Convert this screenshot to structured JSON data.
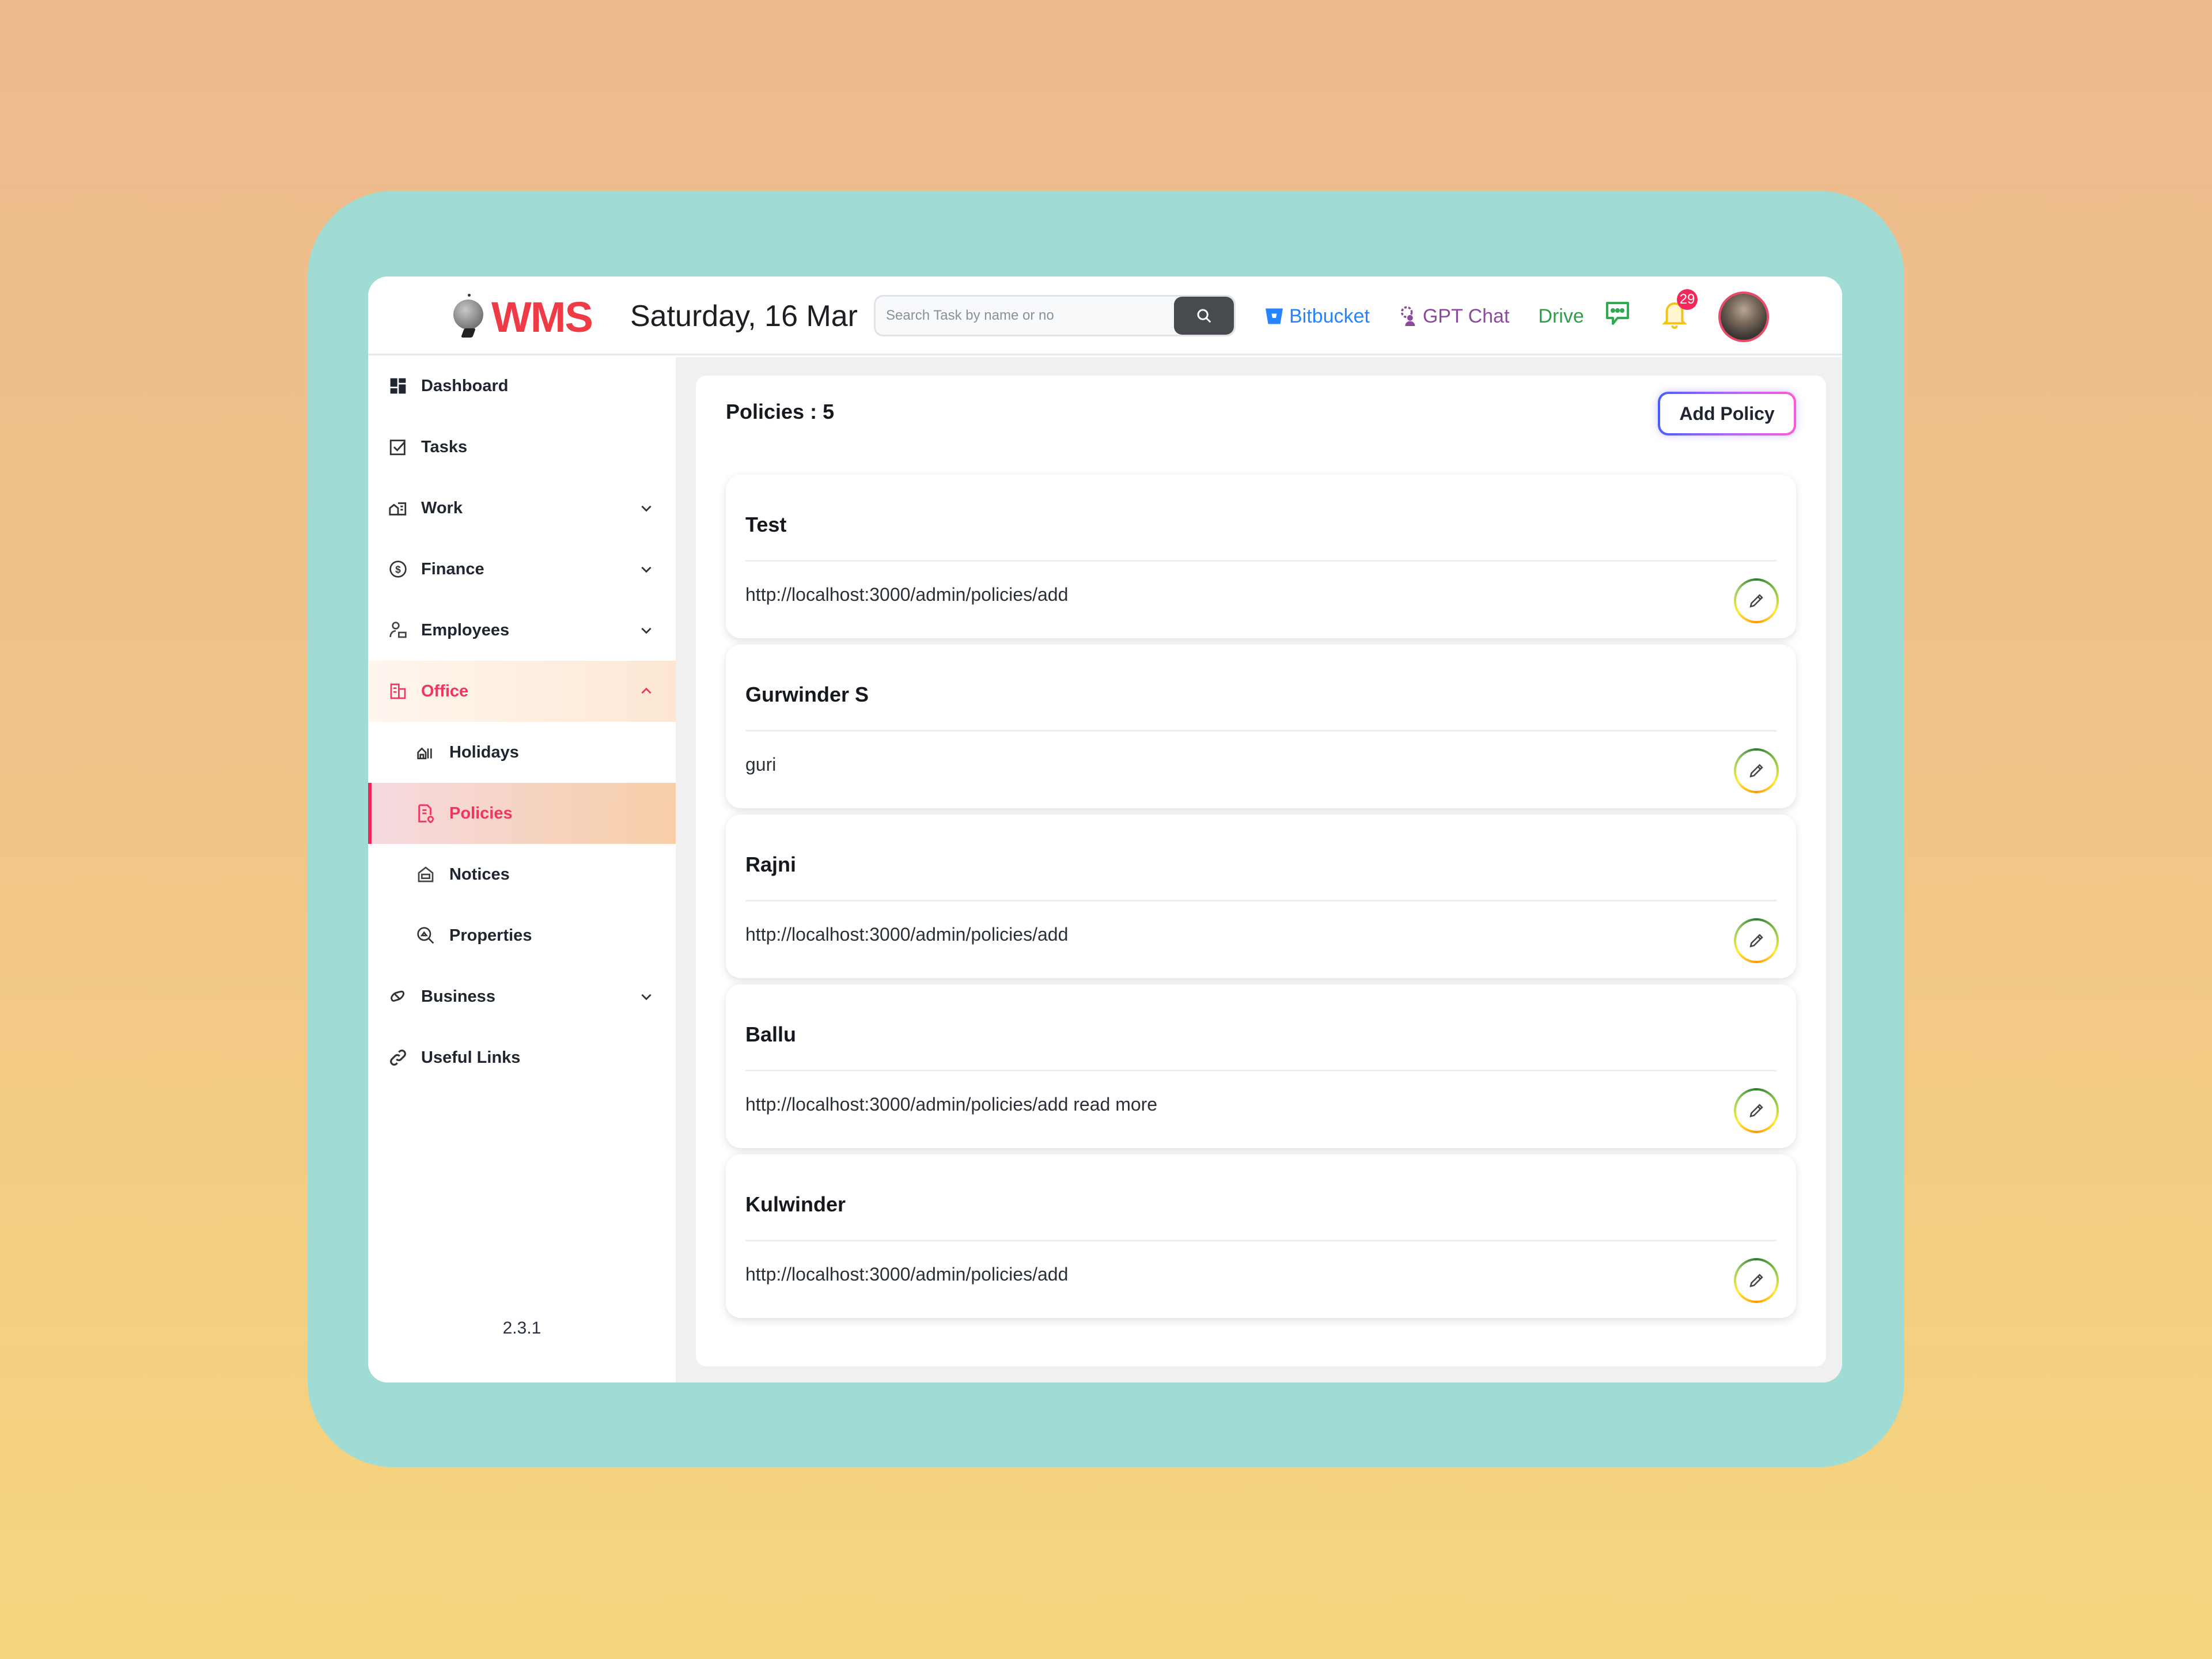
{
  "header": {
    "logo_text": "WMS",
    "date": "Saturday, 16 Mar",
    "search_placeholder": "Search Task by name or no",
    "links": [
      {
        "label": "Bitbucket",
        "icon": "bitbucket-icon"
      },
      {
        "label": "GPT Chat",
        "icon": "gpt-chat-icon"
      },
      {
        "label": "Drive",
        "icon": null
      }
    ],
    "notification_count": "29"
  },
  "sidebar": {
    "items": [
      {
        "label": "Dashboard",
        "icon": "dashboard-icon",
        "expandable": false
      },
      {
        "label": "Tasks",
        "icon": "tasks-icon",
        "expandable": false
      },
      {
        "label": "Work",
        "icon": "work-icon",
        "expandable": true,
        "expanded": false
      },
      {
        "label": "Finance",
        "icon": "finance-icon",
        "expandable": true,
        "expanded": false
      },
      {
        "label": "Employees",
        "icon": "employees-icon",
        "expandable": true,
        "expanded": false
      },
      {
        "label": "Office",
        "icon": "office-icon",
        "expandable": true,
        "expanded": true
      },
      {
        "label": "Holidays",
        "icon": "holidays-icon",
        "sub": true
      },
      {
        "label": "Policies",
        "icon": "policies-icon",
        "sub": true,
        "active": true
      },
      {
        "label": "Notices",
        "icon": "notices-icon",
        "sub": true
      },
      {
        "label": "Properties",
        "icon": "properties-icon",
        "sub": true
      },
      {
        "label": "Business",
        "icon": "business-icon",
        "expandable": true,
        "expanded": false
      },
      {
        "label": "Useful Links",
        "icon": "link-icon",
        "expandable": false
      }
    ],
    "version": "2.3.1"
  },
  "main": {
    "title": "Policies : 5",
    "add_button": "Add Policy",
    "policies": [
      {
        "title": "Test",
        "description": "http://localhost:3000/admin/policies/add"
      },
      {
        "title": "Gurwinder S",
        "description": "guri"
      },
      {
        "title": "Rajni",
        "description": "http://localhost:3000/admin/policies/add"
      },
      {
        "title": "Ballu",
        "description": "http://localhost:3000/admin/policies/add read more"
      },
      {
        "title": "Kulwinder",
        "description": "http://localhost:3000/admin/policies/add"
      }
    ]
  },
  "colors": {
    "brand_red": "#EE3B45",
    "active_pink": "#F0365E",
    "bitbucket_blue": "#2684FF",
    "gpt_purple": "#8B4A9C",
    "drive_green": "#2E9E4A",
    "frame_teal": "#A0DCD4"
  }
}
